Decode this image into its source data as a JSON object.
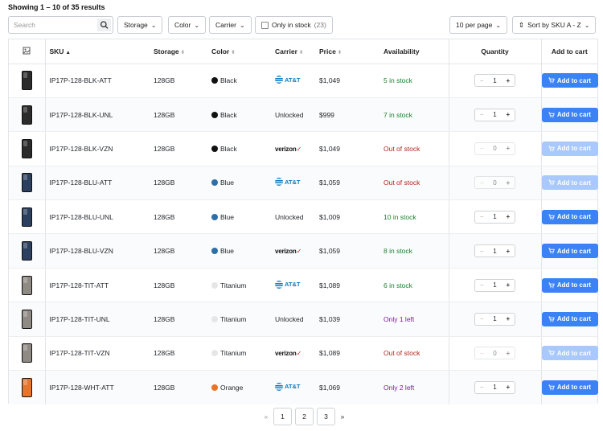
{
  "results_text": "Showing 1 – 10 of 35 results",
  "search": {
    "placeholder": "Search",
    "icon": "search-icon"
  },
  "filters": {
    "storage": "Storage",
    "color": "Color",
    "carrier": "Carrier",
    "in_stock_label": "Only in stock",
    "in_stock_count": "(23)"
  },
  "per_page": "10 per page",
  "sort_label": "Sort by SKU A - Z",
  "columns": [
    "SKU",
    "Storage",
    "Color",
    "Carrier",
    "Price",
    "Availability",
    "Quantity",
    "Add to cart"
  ],
  "add_to_cart_label": "Add to cart",
  "colors": {
    "accent": "#3b82f6",
    "accent_disabled": "#a9c8fb",
    "in_stock": "#1a7f2e",
    "out_of_stock": "#b3261e",
    "low_stock": "#7b1fa2"
  },
  "rows": [
    {
      "sku": "IP17P-128-BLK-ATT",
      "storage": "128GB",
      "color": "Black",
      "swatch": "#111111",
      "phone": "#2b2b2b",
      "carrier": "AT&T",
      "carrier_type": "att",
      "price": "$1,049",
      "availability": "5 in stock",
      "avail_type": "green",
      "qty": "1",
      "disabled": false
    },
    {
      "sku": "IP17P-128-BLK-UNL",
      "storage": "128GB",
      "color": "Black",
      "swatch": "#111111",
      "phone": "#2b2b2b",
      "carrier": "Unlocked",
      "carrier_type": "text",
      "price": "$999",
      "availability": "7 in stock",
      "avail_type": "green",
      "qty": "1",
      "disabled": false
    },
    {
      "sku": "IP17P-128-BLK-VZN",
      "storage": "128GB",
      "color": "Black",
      "swatch": "#111111",
      "phone": "#2b2b2b",
      "carrier": "verizon",
      "carrier_type": "vzn",
      "price": "$1,049",
      "availability": "Out of stock",
      "avail_type": "red",
      "qty": "0",
      "disabled": true
    },
    {
      "sku": "IP17P-128-BLU-ATT",
      "storage": "128GB",
      "color": "Blue",
      "swatch": "#2f6fa8",
      "phone": "#2c3f5e",
      "carrier": "AT&T",
      "carrier_type": "att",
      "price": "$1,059",
      "availability": "Out of stock",
      "avail_type": "red",
      "qty": "0",
      "disabled": true
    },
    {
      "sku": "IP17P-128-BLU-UNL",
      "storage": "128GB",
      "color": "Blue",
      "swatch": "#2f6fa8",
      "phone": "#2c3f5e",
      "carrier": "Unlocked",
      "carrier_type": "text",
      "price": "$1,009",
      "availability": "10 in stock",
      "avail_type": "green",
      "qty": "1",
      "disabled": false
    },
    {
      "sku": "IP17P-128-BLU-VZN",
      "storage": "128GB",
      "color": "Blue",
      "swatch": "#2f6fa8",
      "phone": "#2c3f5e",
      "carrier": "verizon",
      "carrier_type": "vzn",
      "price": "$1,059",
      "availability": "8 in stock",
      "avail_type": "green",
      "qty": "1",
      "disabled": false
    },
    {
      "sku": "IP17P-128-TIT-ATT",
      "storage": "128GB",
      "color": "Titanium",
      "swatch": "#e6e6e6",
      "phone": "#8f8a84",
      "carrier": "AT&T",
      "carrier_type": "att",
      "price": "$1,089",
      "availability": "6 in stock",
      "avail_type": "green",
      "qty": "1",
      "disabled": false
    },
    {
      "sku": "IP17P-128-TIT-UNL",
      "storage": "128GB",
      "color": "Titanium",
      "swatch": "#e6e6e6",
      "phone": "#8f8a84",
      "carrier": "Unlocked",
      "carrier_type": "text",
      "price": "$1,039",
      "availability": "Only 1 left",
      "avail_type": "purple",
      "qty": "1",
      "disabled": false
    },
    {
      "sku": "IP17P-128-TIT-VZN",
      "storage": "128GB",
      "color": "Titanium",
      "swatch": "#e6e6e6",
      "phone": "#8f8a84",
      "carrier": "verizon",
      "carrier_type": "vzn",
      "price": "$1,089",
      "availability": "Out of stock",
      "avail_type": "red",
      "qty": "0",
      "disabled": true
    },
    {
      "sku": "IP17P-128-WHT-ATT",
      "storage": "128GB",
      "color": "Orange",
      "swatch": "#e8742a",
      "phone": "#e8742a",
      "carrier": "AT&T",
      "carrier_type": "att",
      "price": "$1,069",
      "availability": "Only 2 left",
      "avail_type": "purple",
      "qty": "1",
      "disabled": false
    }
  ],
  "pagination": {
    "prev": "«",
    "pages": [
      "1",
      "2",
      "3"
    ],
    "next": "»"
  }
}
